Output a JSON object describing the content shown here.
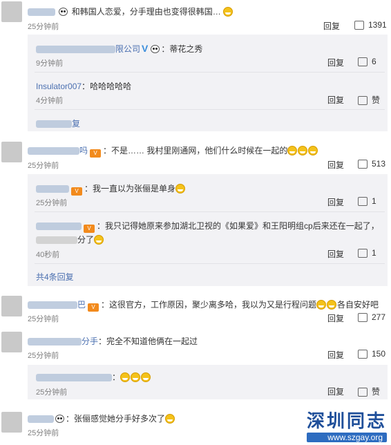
{
  "comments": [
    {
      "text": "和韩国人恋爱，分手理由也变得很韩国…",
      "time": "25分钟前",
      "reply": "回复",
      "likes": "1391"
    },
    {
      "text": "不是…… 我村里刚通网，他们什么时候在一起的",
      "name_tail": "吗",
      "time": "25分钟前",
      "reply": "回复",
      "likes": "513"
    },
    {
      "text": "这很官方，工作原因，聚少离多哈，我以为又是行程问题",
      "text_tail": "各自安好吧",
      "name_tail": "巴",
      "time": "25分钟前",
      "reply": "回复",
      "likes": "277"
    },
    {
      "text": "完全不知道他俩在一起过",
      "name_tail": "分手",
      "time": "25分钟前",
      "reply": "回复",
      "likes": "150"
    },
    {
      "text": "张俪感觉她分手好多次了",
      "time": "25分钟前"
    }
  ],
  "replies_a": [
    {
      "name_tail": "限公司",
      "text": "蒂花之秀",
      "time": "9分钟前",
      "reply": "回复",
      "likes": "6"
    },
    {
      "name": "Insulator007",
      "text": "哈哈哈哈哈",
      "time": "4分钟前",
      "reply": "回复",
      "likes": "赞"
    }
  ],
  "replies_b": [
    {
      "text": "我一直以为张俪是单身",
      "time": "25分钟前",
      "reply": "回复",
      "likes": "1"
    },
    {
      "text": "我只记得她原来参加湖北卫视的《如果爱》和王阳明组cp后来还在一起了，",
      "text2_tail": "分了",
      "time": "40秒前",
      "reply": "回复",
      "likes": "1"
    }
  ],
  "replies_c": [
    {
      "time": "25分钟前",
      "reply": "回复",
      "likes": "赞"
    }
  ],
  "more_a_tail": "复",
  "more_b": "共4条回复",
  "watermark": {
    "title": "深圳同志",
    "url": "www.szgay.org"
  }
}
